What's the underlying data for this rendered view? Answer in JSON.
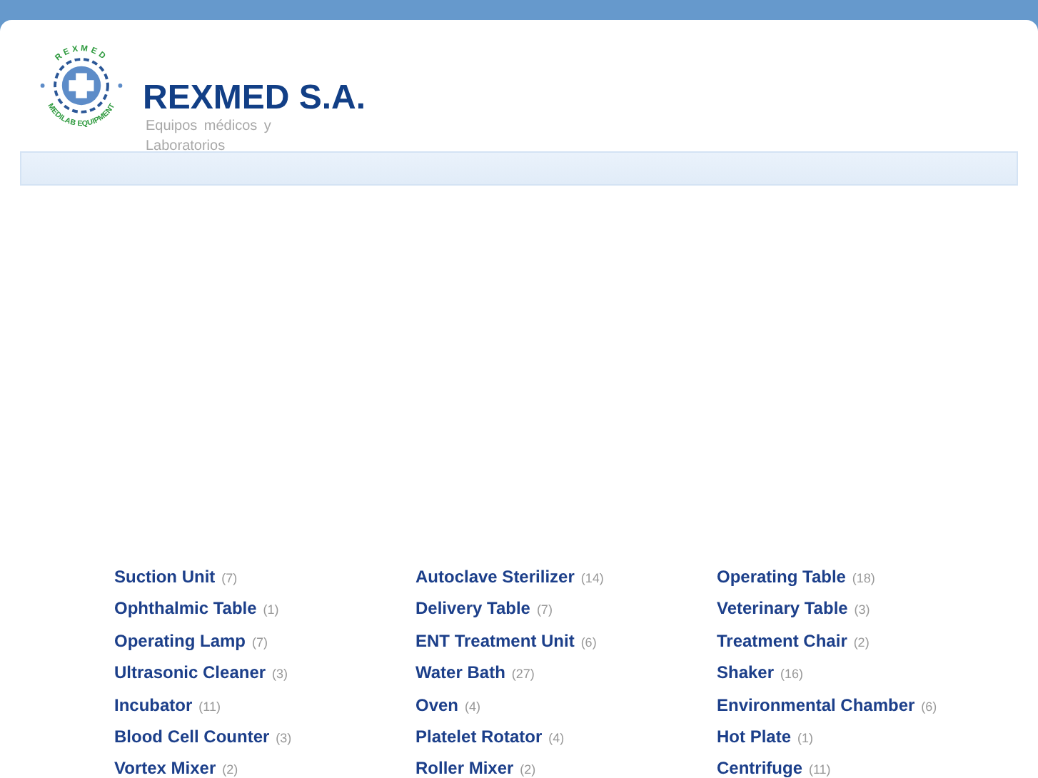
{
  "logo": {
    "top_text": "REXMED",
    "bottom_text": "MEDILAB EQUIPMENT"
  },
  "header": {
    "title": "REXMED S.A.",
    "subtitle": "Equipos  médicos  y Laboratorios"
  },
  "category_columns": [
    [
      {
        "name": "Suction Unit",
        "count": "(7)"
      },
      {
        "name": "Ophthalmic Table",
        "count": "(1)"
      },
      {
        "name": "Operating Lamp",
        "count": "(7)"
      },
      {
        "name": "Ultrasonic Cleaner",
        "count": "(3)"
      },
      {
        "name": "Incubator",
        "count": "(11)"
      },
      {
        "name": "Blood Cell Counter",
        "count": "(3)"
      },
      {
        "name": "Vortex Mixer",
        "count": "(2)"
      }
    ],
    [
      {
        "name": "Autoclave Sterilizer",
        "count": "(14)"
      },
      {
        "name": "Delivery Table",
        "count": "(7)"
      },
      {
        "name": "ENT Treatment Unit",
        "count": "(6)"
      },
      {
        "name": "Water Bath",
        "count": "(27)"
      },
      {
        "name": "Oven",
        "count": "(4)"
      },
      {
        "name": "Platelet Rotator",
        "count": "(4)"
      },
      {
        "name": "Roller Mixer",
        "count": "(2)"
      }
    ],
    [
      {
        "name": "Operating Table",
        "count": "(18)"
      },
      {
        "name": "Veterinary Table",
        "count": "(3)"
      },
      {
        "name": "Treatment Chair",
        "count": "(2)"
      },
      {
        "name": "Shaker",
        "count": "(16)"
      },
      {
        "name": "Environmental Chamber",
        "count": "(6)"
      },
      {
        "name": "Hot Plate",
        "count": "(1)"
      },
      {
        "name": "Centrifuge",
        "count": "(11)"
      }
    ]
  ]
}
